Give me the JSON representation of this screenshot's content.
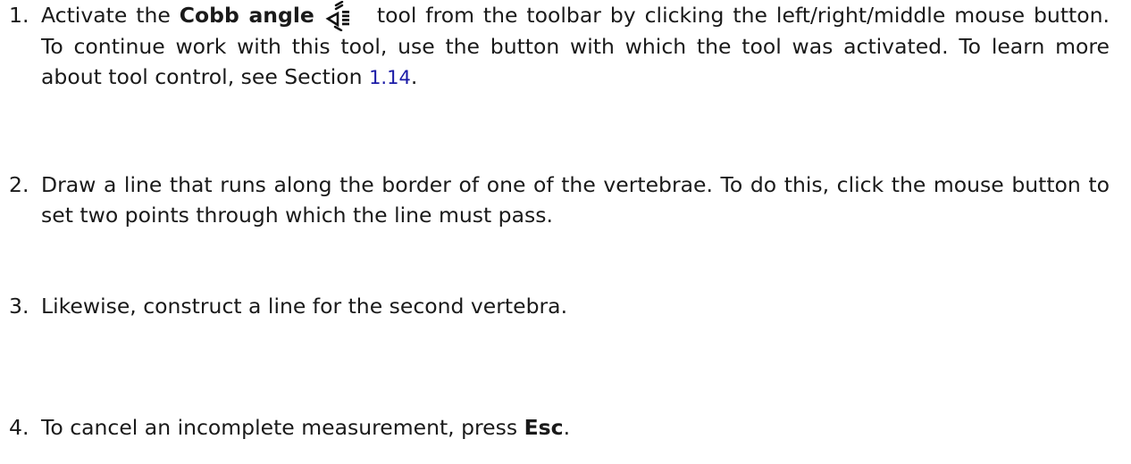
{
  "steps": [
    {
      "number": "1.",
      "pre": "Activate the ",
      "tool_name": "Cobb angle",
      "post_icon": "tool from the toolbar by clicking the left/right/middle mouse button. To continue work with this tool, use the button with which the tool was activated. To learn more about tool control, see Section ",
      "section_link": "1.14",
      "end": ".",
      "icon": "cobb-angle-icon"
    },
    {
      "number": "2.",
      "text": "Draw a line that runs along the border of one of the vertebrae. To do this, click the mouse button to set two points through which the line must pass."
    },
    {
      "number": "3.",
      "text": "Likewise, construct a line for the second vertebra."
    },
    {
      "number": "4.",
      "pre": "To cancel an incomplete measurement, press ",
      "key": "Esc",
      "end": "."
    }
  ],
  "colors": {
    "text": "#1a1a1a",
    "link": "#1a1aa6"
  }
}
